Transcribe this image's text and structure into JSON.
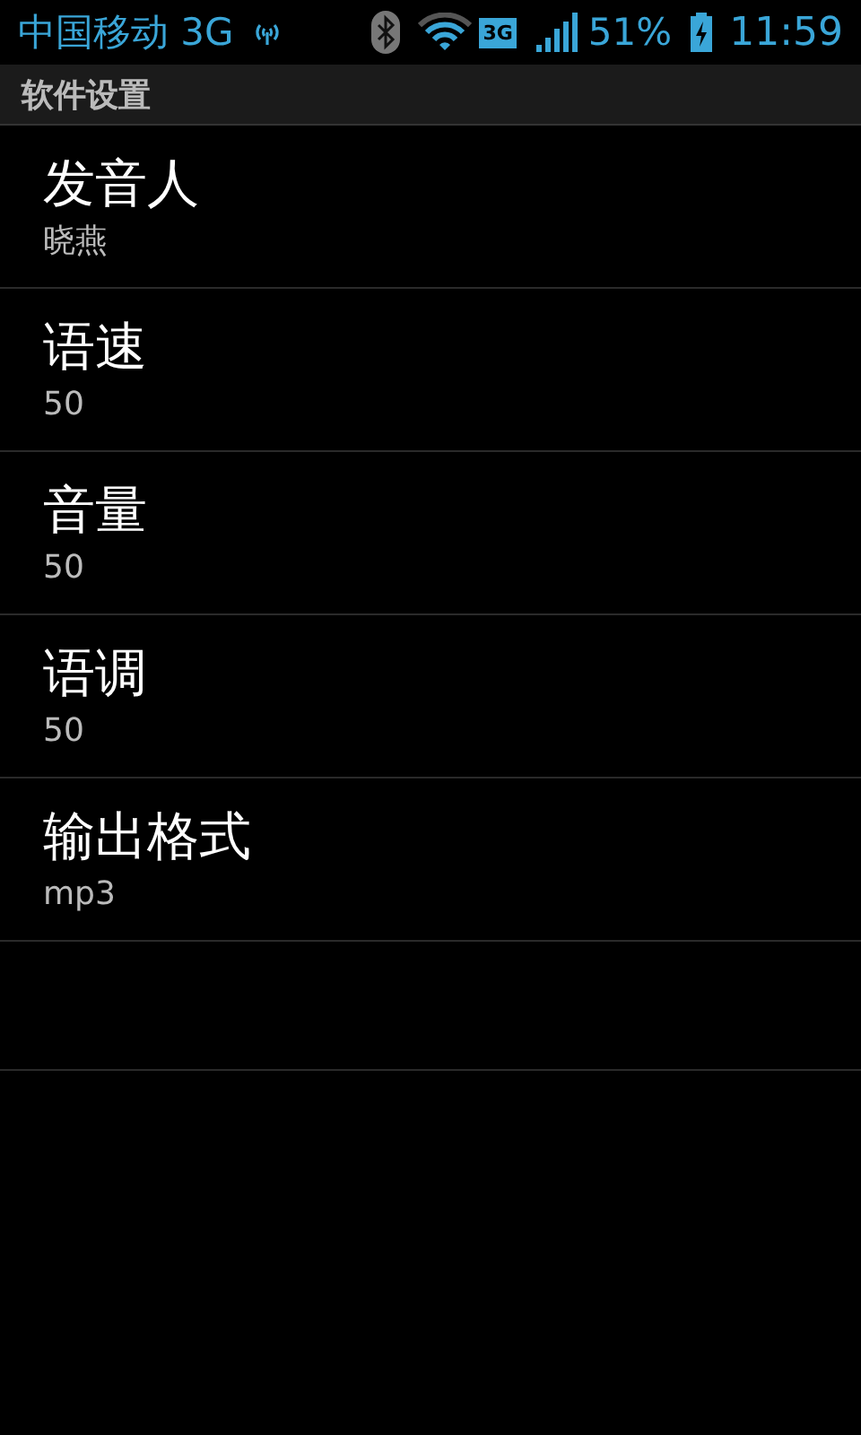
{
  "status_bar": {
    "carrier": "中国移动 3G",
    "network_badge": "3G",
    "battery": "51%",
    "time": "11:59"
  },
  "header": {
    "title": "软件设置"
  },
  "settings": [
    {
      "title": "发音人",
      "summary": "晓燕"
    },
    {
      "title": "语速",
      "summary": "50"
    },
    {
      "title": "音量",
      "summary": "50"
    },
    {
      "title": "语调",
      "summary": "50"
    },
    {
      "title": "输出格式",
      "summary": "mp3"
    }
  ]
}
